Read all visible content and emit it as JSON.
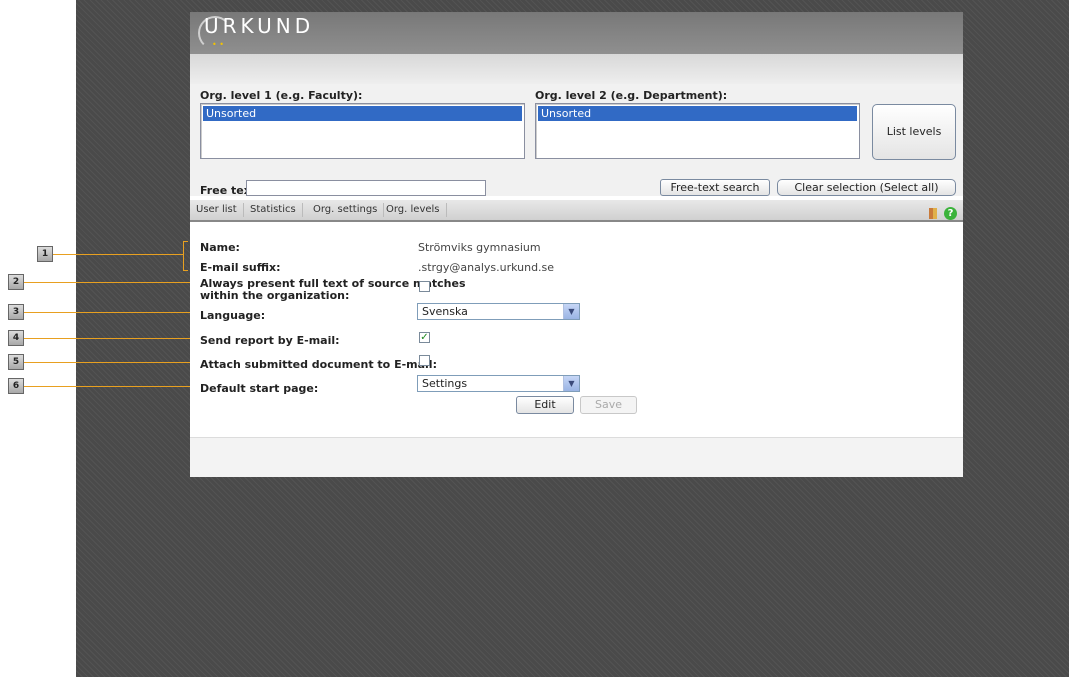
{
  "app": {
    "logo_text": "URKUND"
  },
  "filters": {
    "org_level1_label": "Org. level 1 (e.g. Faculty):",
    "org_level1_selected": "Unsorted",
    "org_level2_label": "Org. level 2 (e.g. Department):",
    "org_level2_selected": "Unsorted",
    "list_levels_button": "List levels",
    "free_text_label": "Free text",
    "free_text_value": "",
    "free_text_search_button": "Free-text search",
    "clear_selection_button": "Clear selection (Select all)"
  },
  "tabs": [
    {
      "label": "User list"
    },
    {
      "label": "Statistics"
    },
    {
      "label": "Org. settings"
    },
    {
      "label": "Org. levels"
    }
  ],
  "form": {
    "name_label": "Name:",
    "name_value": "Strömviks gymnasium",
    "email_suffix_label": "E-mail suffix:",
    "email_suffix_value": ".strgy@analys.urkund.se",
    "always_present_label_line1": "Always present full text of source matches",
    "always_present_label_line2": "within the organization:",
    "always_present_checked": false,
    "language_label": "Language:",
    "language_value": "Svenska",
    "send_report_label": "Send report by E-mail:",
    "send_report_checked": true,
    "attach_doc_label": "Attach submitted document to E-mail:",
    "attach_doc_checked": false,
    "default_start_label": "Default start page:",
    "default_start_value": "Settings",
    "edit_button": "Edit",
    "save_button": "Save"
  },
  "callouts": [
    "1",
    "2",
    "3",
    "4",
    "5",
    "6"
  ],
  "colors": {
    "accent": "#e8a020",
    "selection": "#316ac5",
    "header": "#808080",
    "check": "#1e8a1e"
  },
  "icons": [
    "book-icon",
    "help-icon",
    "chevron-down-icon",
    "checkmark-icon"
  ]
}
